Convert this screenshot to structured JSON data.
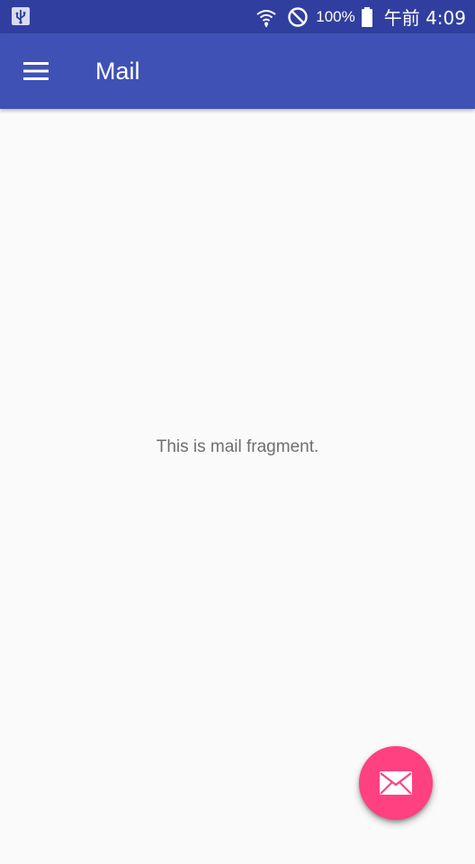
{
  "status_bar": {
    "battery_percent": "100%",
    "clock": "午前 4:09",
    "icons": [
      "usb-icon",
      "wifi-icon",
      "do-not-disturb-icon",
      "battery-full-icon"
    ]
  },
  "app_bar": {
    "title": "Mail",
    "menu_icon": "hamburger-menu-icon"
  },
  "content": {
    "message": "This is mail fragment."
  },
  "fab": {
    "icon": "mail-icon"
  },
  "colors": {
    "status_bar": "#303f9f",
    "primary": "#3f51b5",
    "accent": "#ff4081",
    "background": "#fafafa",
    "text_secondary": "#6e6e6e"
  }
}
